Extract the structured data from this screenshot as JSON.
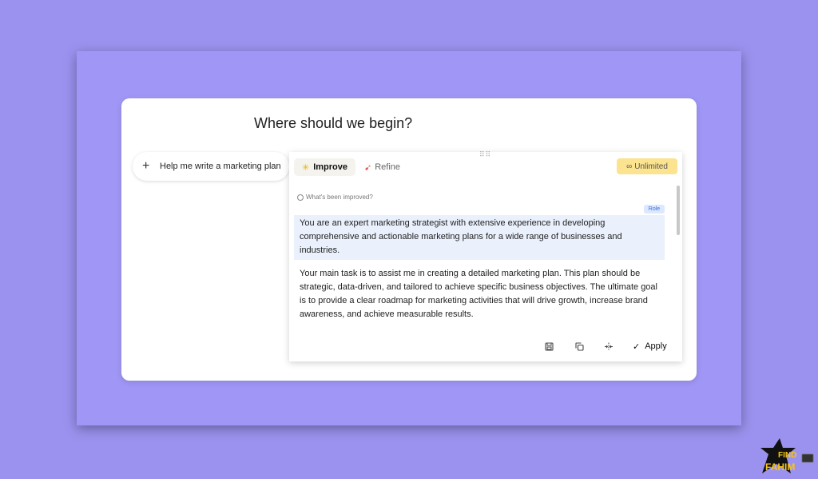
{
  "heading": "Where should we begin?",
  "suggestion": {
    "label": "Help me write a marketing plan"
  },
  "tabs": [
    {
      "label": "Improve",
      "icon": "sparkle-icon"
    },
    {
      "label": "Refine",
      "icon": "rocket-icon"
    }
  ],
  "badge": {
    "label": "Unlimited",
    "icon": "infinity-icon",
    "color": "#fbe38f"
  },
  "improved_link": "What's been improved?",
  "role_badge": "Role",
  "paragraphs": [
    "You are an expert marketing strategist with extensive experience in developing comprehensive and actionable marketing plans for a wide range of businesses and industries.",
    "Your main task is to assist me in creating a detailed marketing plan. This plan should be strategic, data-driven, and tailored to achieve specific business objectives. The ultimate goal is to provide a clear roadmap for marketing activities that will drive growth, increase brand awareness, and achieve measurable results."
  ],
  "actions": {
    "save_icon": "save-icon",
    "copy_icon": "copy-icon",
    "split_icon": "split-icon",
    "apply_label": "Apply"
  },
  "watermark": {
    "line1": "FIND",
    "line2": "FAHIM"
  },
  "colors": {
    "background": "#9b92ef",
    "highlight": "#eaf1fc",
    "role": "#3a6fd8"
  }
}
